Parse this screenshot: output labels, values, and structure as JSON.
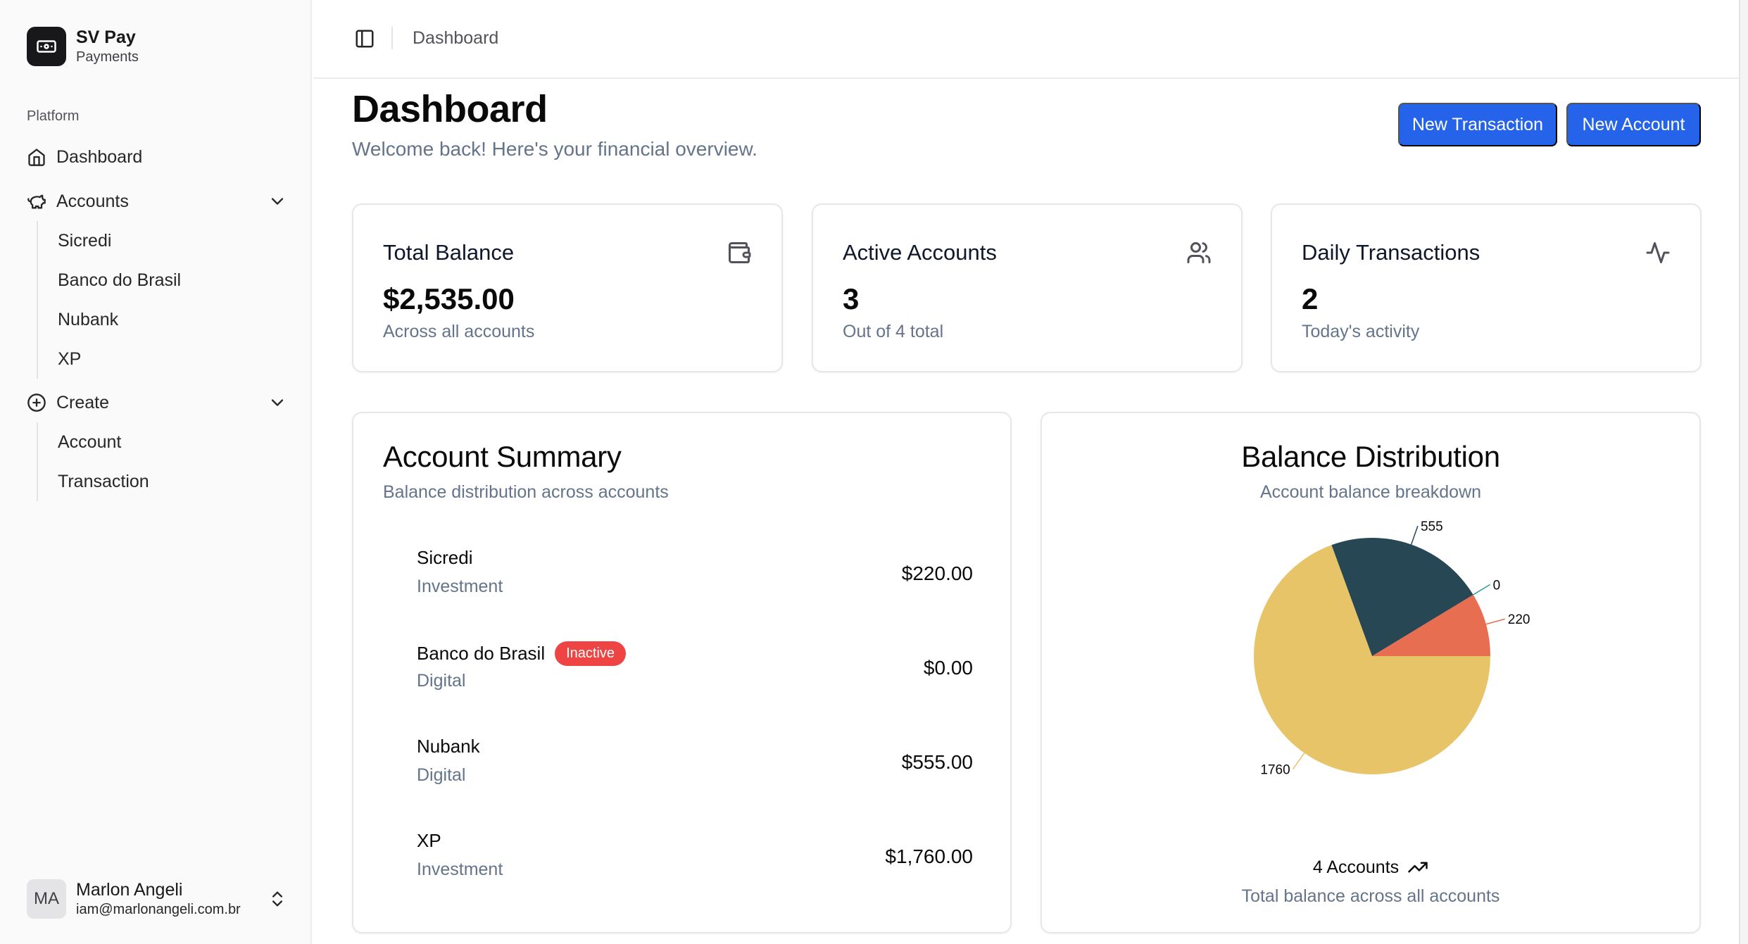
{
  "brand": {
    "name": "SV Pay",
    "subtitle": "Payments"
  },
  "sidebar": {
    "group_label": "Platform",
    "dashboard_label": "Dashboard",
    "accounts_label": "Accounts",
    "accounts_items": [
      "Sicredi",
      "Banco do Brasil",
      "Nubank",
      "XP"
    ],
    "create_label": "Create",
    "create_items": [
      "Account",
      "Transaction"
    ]
  },
  "user": {
    "initials": "MA",
    "name": "Marlon Angeli",
    "email": "iam@marlonangeli.com.br"
  },
  "header": {
    "breadcrumb": "Dashboard"
  },
  "page": {
    "title": "Dashboard",
    "subtitle": "Welcome back! Here's your financial overview.",
    "new_transaction_label": "New Transaction",
    "new_account_label": "New Account"
  },
  "stats": [
    {
      "title": "Total Balance",
      "value": "$2,535.00",
      "sub": "Across all accounts",
      "icon": "wallet-icon"
    },
    {
      "title": "Active Accounts",
      "value": "3",
      "sub": "Out of 4 total",
      "icon": "users-icon"
    },
    {
      "title": "Daily Transactions",
      "value": "2",
      "sub": "Today's activity",
      "icon": "activity-icon"
    }
  ],
  "summary": {
    "title": "Account Summary",
    "subtitle": "Balance distribution across accounts",
    "accounts": [
      {
        "name": "Sicredi",
        "type": "Investment",
        "amount": "$220.00",
        "badge": ""
      },
      {
        "name": "Banco do Brasil",
        "type": "Digital",
        "amount": "$0.00",
        "badge": "Inactive"
      },
      {
        "name": "Nubank",
        "type": "Digital",
        "amount": "$555.00",
        "badge": ""
      },
      {
        "name": "XP",
        "type": "Investment",
        "amount": "$1,760.00",
        "badge": ""
      }
    ]
  },
  "distribution": {
    "title": "Balance Distribution",
    "subtitle": "Account balance breakdown",
    "footer_main": "4 Accounts",
    "footer_sub": "Total balance across all accounts"
  },
  "chart_data": {
    "type": "pie",
    "slices": [
      {
        "label": "220",
        "value": 220,
        "color": "#e76e50"
      },
      {
        "label": "0",
        "value": 0,
        "color": "#2a9d90"
      },
      {
        "label": "555",
        "value": 555,
        "color": "#274754"
      },
      {
        "label": "1760",
        "value": 1760,
        "color": "#e8c468"
      }
    ]
  }
}
